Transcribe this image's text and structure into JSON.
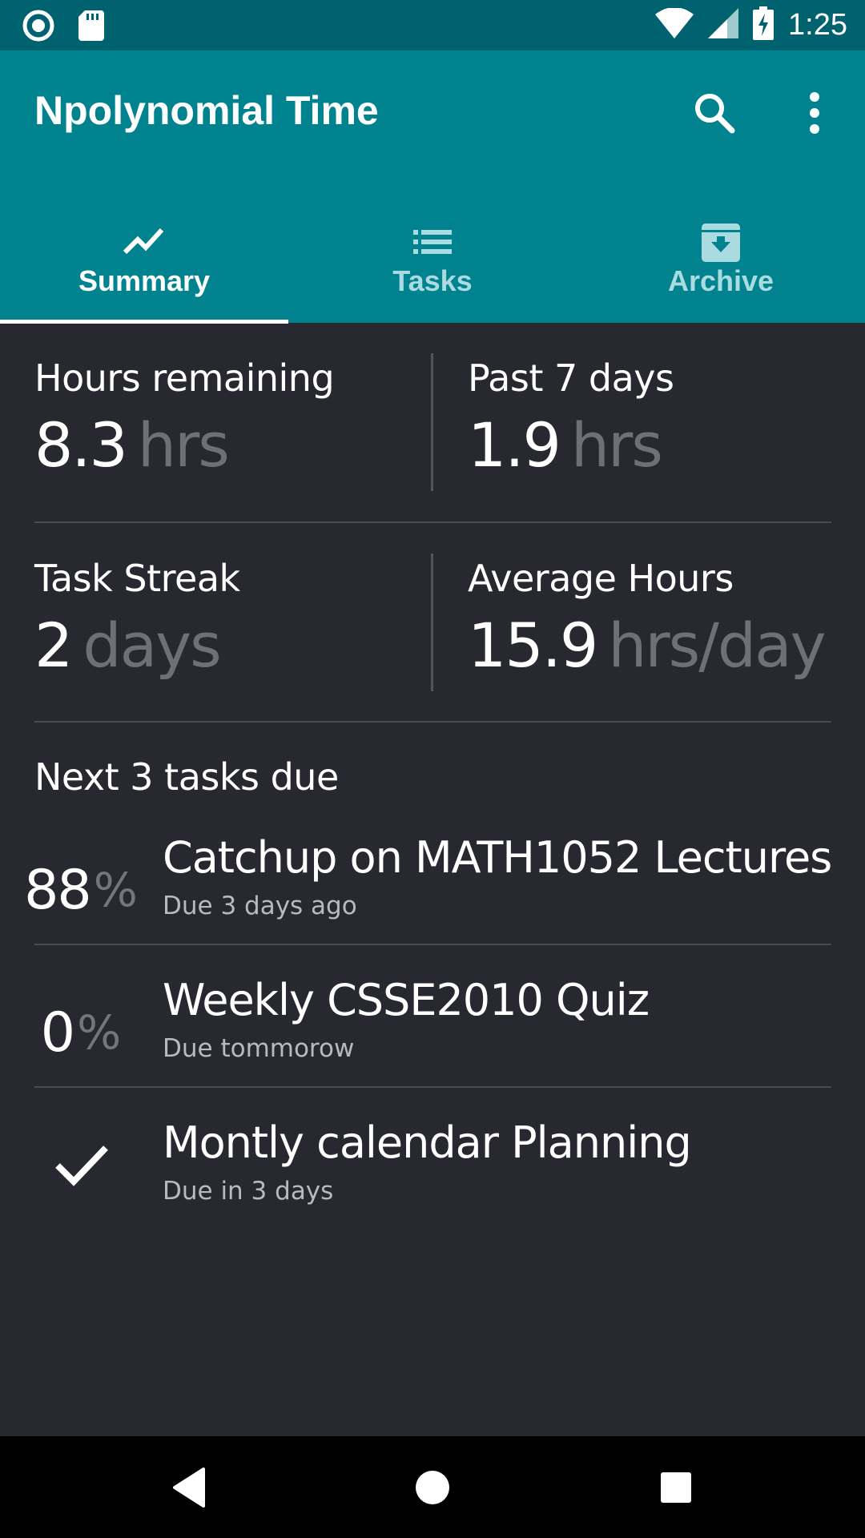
{
  "status_bar": {
    "time": "1:25",
    "icons": [
      "record-icon",
      "sd-card-icon",
      "wifi-icon",
      "signal-icon",
      "battery-charging-icon"
    ]
  },
  "app_bar": {
    "title": "Npolynomial Time",
    "actions": [
      "search-icon",
      "more-vert-icon"
    ]
  },
  "tabs": [
    {
      "label": "Summary",
      "icon": "trending-icon",
      "active": true
    },
    {
      "label": "Tasks",
      "icon": "list-icon",
      "active": false
    },
    {
      "label": "Archive",
      "icon": "archive-icon",
      "active": false
    }
  ],
  "stats": {
    "hours_remaining": {
      "label": "Hours remaining",
      "value": "8.3",
      "unit": "hrs"
    },
    "past_7_days": {
      "label": "Past 7 days",
      "value": "1.9",
      "unit": "hrs"
    },
    "task_streak": {
      "label": "Task Streak",
      "value": "2",
      "unit": "days"
    },
    "average_hours": {
      "label": "Average Hours",
      "value": "15.9",
      "unit": "hrs/day"
    }
  },
  "next_tasks": {
    "title": "Next 3 tasks due",
    "items": [
      {
        "progress": "88",
        "percent_sign": "%",
        "name": "Catchup on MATH1052 Lectures",
        "due": "Due 3 days ago",
        "completed": false
      },
      {
        "progress": "0",
        "percent_sign": "%",
        "name": "Weekly CSSE2010 Quiz",
        "due": "Due tommorow",
        "completed": false
      },
      {
        "name": "Montly calendar Planning",
        "due": "Due in 3 days",
        "completed": true,
        "icon": "check-icon"
      }
    ]
  },
  "nav_bar": {
    "buttons": [
      "back-icon",
      "home-icon",
      "recents-icon"
    ]
  },
  "colors": {
    "primary": "#00838f",
    "primary_dark": "#00626e",
    "background": "#272830",
    "unit_text": "#6f7075",
    "inactive_tab": "#a9dbe0"
  }
}
